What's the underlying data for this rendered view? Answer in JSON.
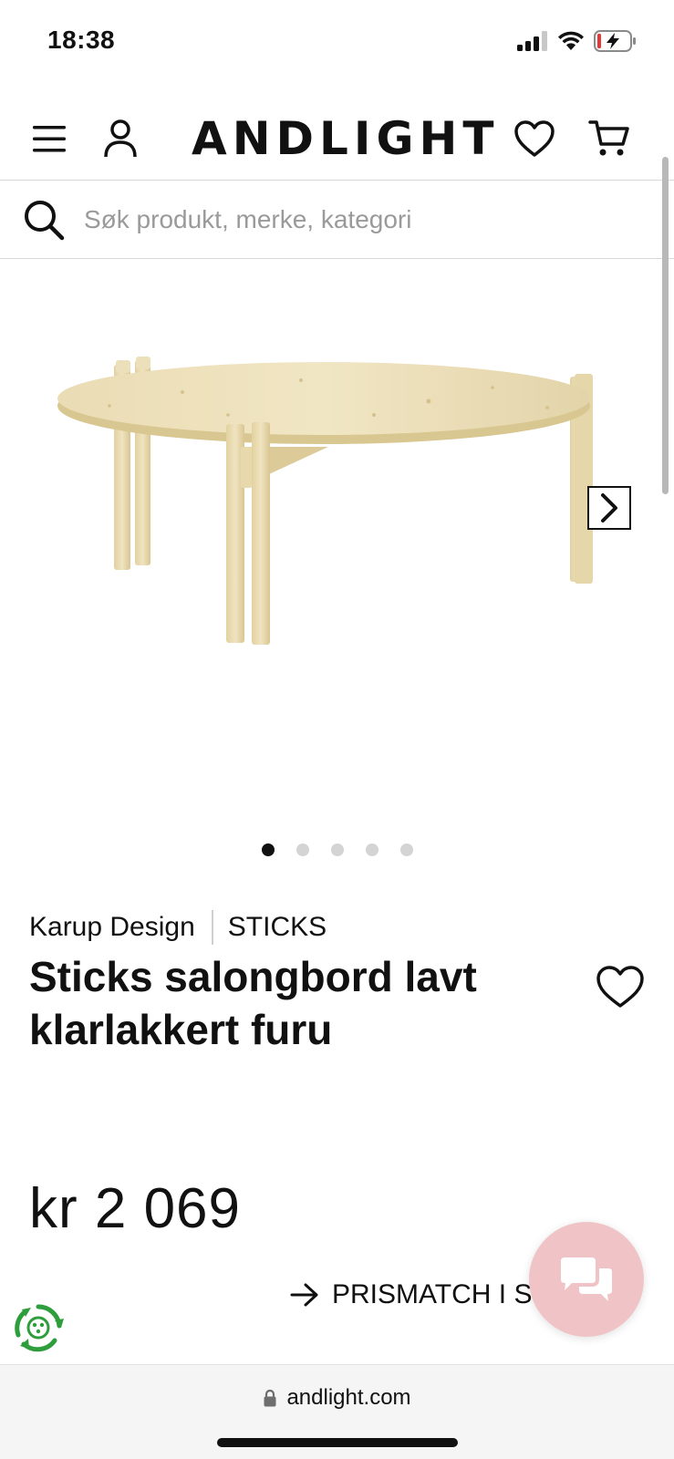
{
  "status_bar": {
    "time": "18:38"
  },
  "header": {
    "logo": "ANDLIGHT",
    "icons": [
      "menu-icon",
      "account-icon",
      "wishlist-icon",
      "cart-icon"
    ]
  },
  "search": {
    "placeholder": "Søk produkt, merke, kategori"
  },
  "gallery": {
    "image_count": 5,
    "active_index": 0
  },
  "product": {
    "brand": "Karup Design",
    "series": "STICKS",
    "title": "Sticks salongbord lavt klarlakkert furu",
    "price": "kr 2 069",
    "price_match_label": "PRISMATCH I S"
  },
  "browser": {
    "url": "andlight.com"
  },
  "colors": {
    "text": "#111111",
    "chat_bubble": "#f0c4c6",
    "eco_green": "#2e9d3c",
    "battery_low": "#e53935"
  }
}
